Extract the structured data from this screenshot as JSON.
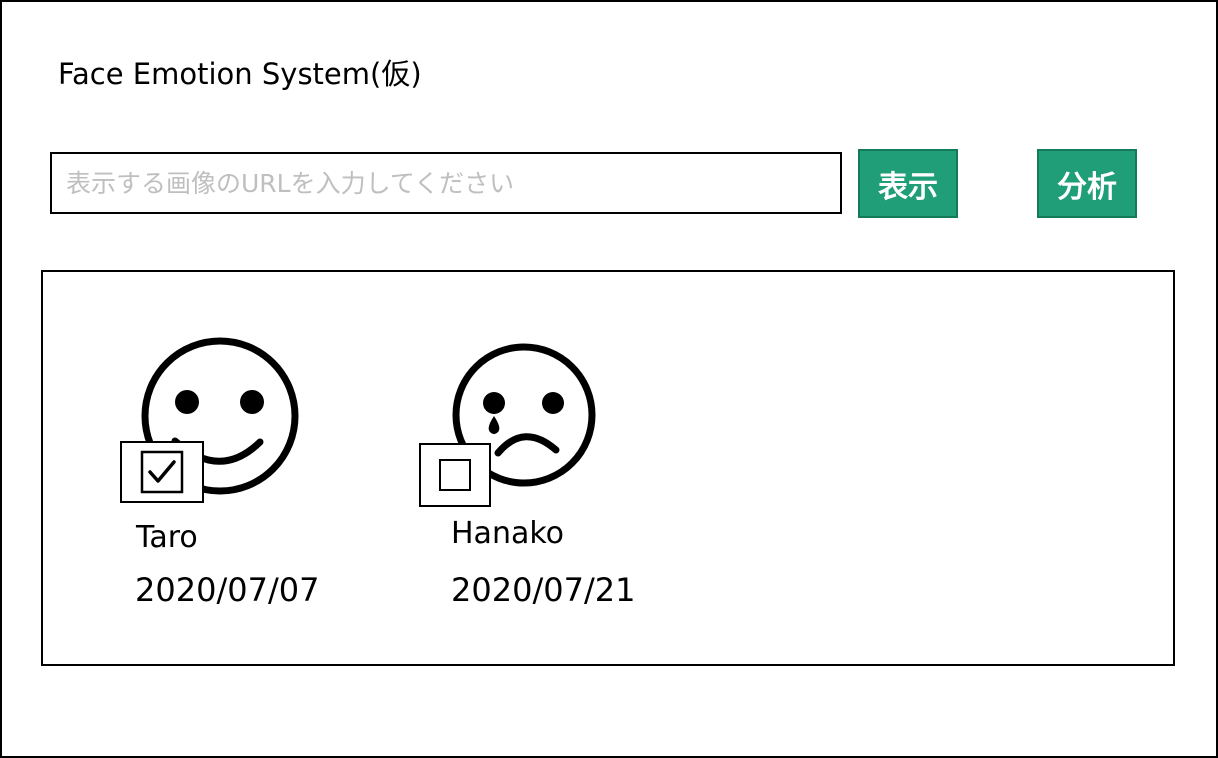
{
  "app": {
    "title": "Face Emotion System(仮)"
  },
  "search": {
    "placeholder": "表示する画像のURLを入力してください",
    "value": ""
  },
  "toolbar": {
    "show_label": "表示",
    "analyze_label": "分析"
  },
  "colors": {
    "button_bg": "#1f9e77",
    "button_border": "#137a5a",
    "placeholder": "#bfbfbf"
  },
  "items": [
    {
      "name": "Taro",
      "date": "2020/07/07",
      "emotion_icon": "smiley-face-icon",
      "checked": true
    },
    {
      "name": "Hanako",
      "date": "2020/07/21",
      "emotion_icon": "crying-face-icon",
      "checked": false
    }
  ]
}
